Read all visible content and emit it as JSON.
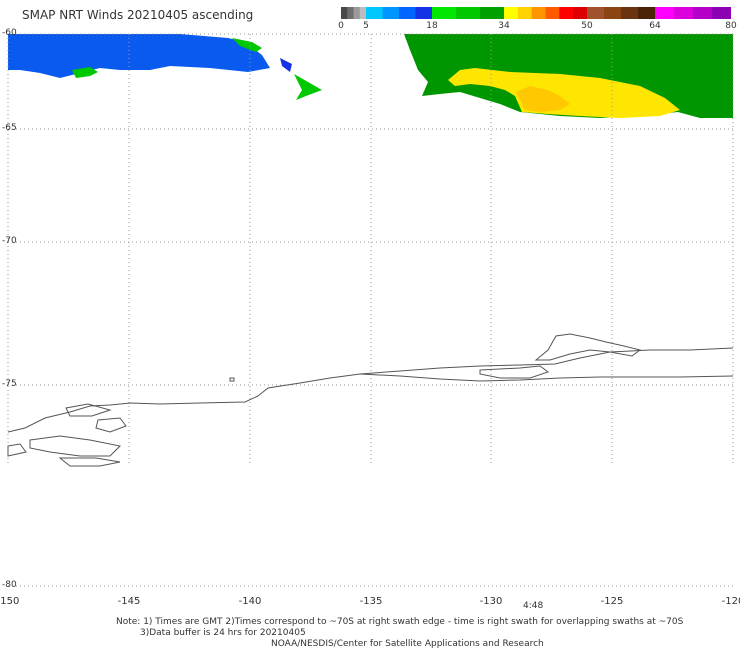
{
  "title": "SMAP NRT Winds 20210405 ascending",
  "colorbar": {
    "tick_labels": [
      "0",
      "5",
      "18",
      "34",
      "50",
      "64",
      "80"
    ],
    "segments": [
      {
        "from": 0,
        "to": 5,
        "colors": [
          "#4a4a4a",
          "#6e6e6e",
          "#9a9a9a",
          "#bcbcbc"
        ]
      },
      {
        "from": 5,
        "to": 18,
        "colors": [
          "#00c8ff",
          "#0096ff",
          "#0064ff",
          "#1432e6"
        ]
      },
      {
        "from": 18,
        "to": 34,
        "colors": [
          "#00e600",
          "#00c800",
          "#00a000"
        ]
      },
      {
        "from": 34,
        "to": 50,
        "colors": [
          "#ffff00",
          "#ffd200",
          "#ff9600",
          "#ff5a00",
          "#ff0000",
          "#dc0000"
        ]
      },
      {
        "from": 50,
        "to": 64,
        "colors": [
          "#a0522d",
          "#8b4513",
          "#6b3410",
          "#4a2308"
        ]
      },
      {
        "from": 64,
        "to": 80,
        "colors": [
          "#ff00ff",
          "#dc00dc",
          "#b400c8",
          "#8c00b4"
        ]
      }
    ]
  },
  "latitude_labels": [
    "-60",
    "-65",
    "-70",
    "-75",
    "-80"
  ],
  "longitude_labels": [
    "-150",
    "-145",
    "-140",
    "-135",
    "-130",
    "-125",
    "-120"
  ],
  "time_label": "4:48",
  "notes": [
    "Note: 1) Times are GMT 2)Times correspond to ~70S at right swath edge - time is right swath for overlapping swaths at ~70S",
    "3)Data buffer is 24 hrs for 20210405",
    "NOAA/NESDIS/Center for Satellite Applications and Research"
  ],
  "wind_colors": {
    "blue": "#0a5af0",
    "deep_blue": "#1432e6",
    "green": "#00c800",
    "dark_green": "#009600",
    "yellow": "#ffe600",
    "orange": "#ffc800"
  },
  "coast_color": "#555555",
  "grid_color": "#9a9a9a"
}
